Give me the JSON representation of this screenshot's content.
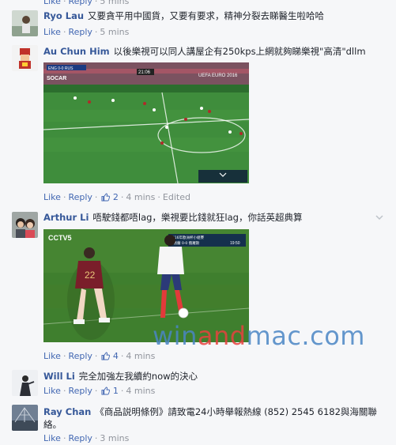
{
  "top_remnant": {
    "like": "Like",
    "reply": "Reply",
    "time": "5 mins"
  },
  "comments": [
    {
      "author": "Ryo Lau",
      "text": "又要貪平用中國貨，又要有要求，精神分裂去睇醫生啦哈哈",
      "like": "Like",
      "reply": "Reply",
      "time": "5 mins"
    },
    {
      "author": "Au Chun Him",
      "text": "以後樂視可以同人講屋企有250kps上網就夠睇樂視\"高清\"dllm",
      "like": "Like",
      "reply": "Reply",
      "reactions": "2",
      "time": "4 mins",
      "edited": "Edited",
      "media": {
        "score_left": "ENG",
        "score": "0-0",
        "score_right": "RUS",
        "clock": "21:06",
        "sponsor": "SOCAR",
        "event": "UEFA EURO 2016"
      }
    },
    {
      "author": "Arthur Li",
      "text": "唔駛錢都唔lag，樂視要比錢就狂lag，你話英超典算",
      "like": "Like",
      "reply": "Reply",
      "reactions": "4",
      "time": "4 mins",
      "media": {
        "channel": "CCTV5",
        "event": "2016年歐洲杯小組賽",
        "score_left": "英格蘭",
        "score": "0-0",
        "score_right": "俄羅斯",
        "clock": "19:50",
        "player_number": "22"
      }
    },
    {
      "author": "Will Li",
      "text": "完全加強左我續約now的決心",
      "like": "Like",
      "reply": "Reply",
      "reactions": "1",
      "time": "4 mins"
    },
    {
      "author": "Ray Chan",
      "text": "《商品説明條例》請致電24小時舉報熱線 (852) 2545 6182與海關聯絡。",
      "like": "Like",
      "reply": "Reply",
      "time": "3 mins"
    }
  ],
  "watermark": {
    "part1": "win",
    "part2": "and",
    "part3": "mac.com"
  },
  "colors": {
    "link": "#4267b2",
    "author": "#365899",
    "meta": "#90949c",
    "background": "#f6f7f9",
    "pitch": "#2f7d2f"
  }
}
